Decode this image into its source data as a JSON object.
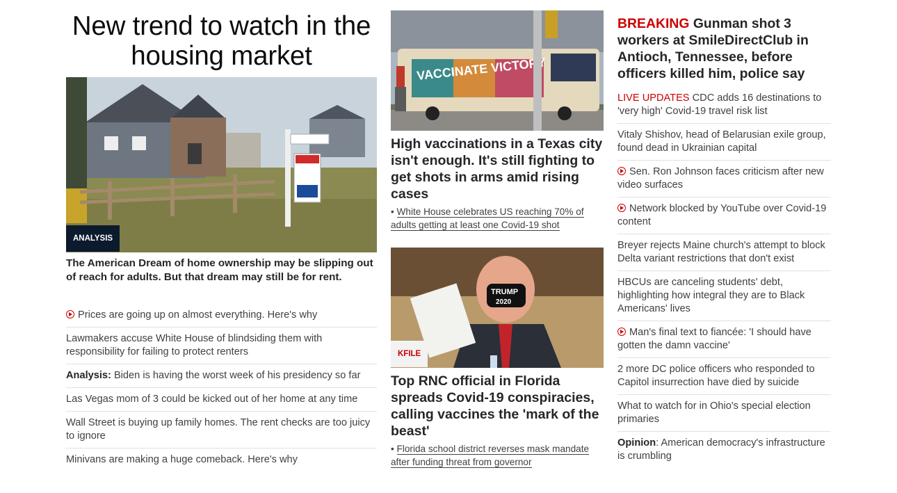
{
  "left": {
    "headline": "New trend to watch in the housing market",
    "image_tag": "ANALYSIS",
    "lead": "The American Dream of home ownership may be slipping out of reach for adults. But that dream may still be for rent.",
    "items": [
      {
        "text": "Prices are going up on almost everything. Here's why",
        "video": true
      },
      {
        "text": "Lawmakers accuse White House of blindsiding them with responsibility for failing to protect renters"
      },
      {
        "prefix": "Analysis:",
        "text": " Biden is having the worst week of his presidency so far"
      },
      {
        "text": "Las Vegas mom of 3 could be kicked out of her home at any time"
      },
      {
        "text": "Wall Street is buying up family homes. The rent checks are too juicy to ignore"
      },
      {
        "text": "Minivans are making a huge comeback. Here's why"
      }
    ]
  },
  "middle": {
    "story1": {
      "image_text": "VACCINATE VICTORY",
      "headline": "High vaccinations in a Texas city isn't enough. It's still fighting to get shots in arms amid rising cases",
      "sub_bullet": "•",
      "sub_text": "White House celebrates US reaching 70% of adults getting at least one Covid-19 shot"
    },
    "story2": {
      "image_tag": "KFILE",
      "mask_text_1": "TRUMP",
      "mask_text_2": "2020",
      "headline": "Top RNC official in Florida spreads Covid-19 conspiracies, calling vaccines the 'mark of the beast'",
      "sub_bullet": "•",
      "sub_text": "Florida school district reverses mask mandate after funding threat from governor"
    }
  },
  "right": {
    "breaking_label": "BREAKING",
    "breaking_text": "Gunman shot 3 workers at SmileDirectClub in Antioch, Tennessee, before officers killed him, police say",
    "items": [
      {
        "prefix": "LIVE UPDATES",
        "text": "CDC adds 16 destinations to 'very high' Covid-19 travel risk list"
      },
      {
        "text": "Vitaly Shishov, head of Belarusian exile group, found dead in Ukrainian capital"
      },
      {
        "text": "Sen. Ron Johnson faces criticism after new video surfaces",
        "video": true
      },
      {
        "text": "Network blocked by YouTube over Covid-19 content",
        "video": true
      },
      {
        "text": "Breyer rejects Maine church's attempt to block Delta variant restrictions that don't exist"
      },
      {
        "text": "HBCUs are canceling students' debt, highlighting how integral they are to Black Americans' lives"
      },
      {
        "text": "Man's final text to fiancée: 'I should have gotten the damn vaccine'",
        "video": true
      },
      {
        "text": "2 more DC police officers who responded to Capitol insurrection have died by suicide"
      },
      {
        "text": "What to watch for in Ohio's special election primaries"
      },
      {
        "prefix": "Opinion",
        "text": ": American democracy's infrastructure is crumbling"
      }
    ]
  },
  "colors": {
    "accent_red": "#cc0000",
    "tag_dark": "#0c1a2e",
    "text": "#262626"
  }
}
